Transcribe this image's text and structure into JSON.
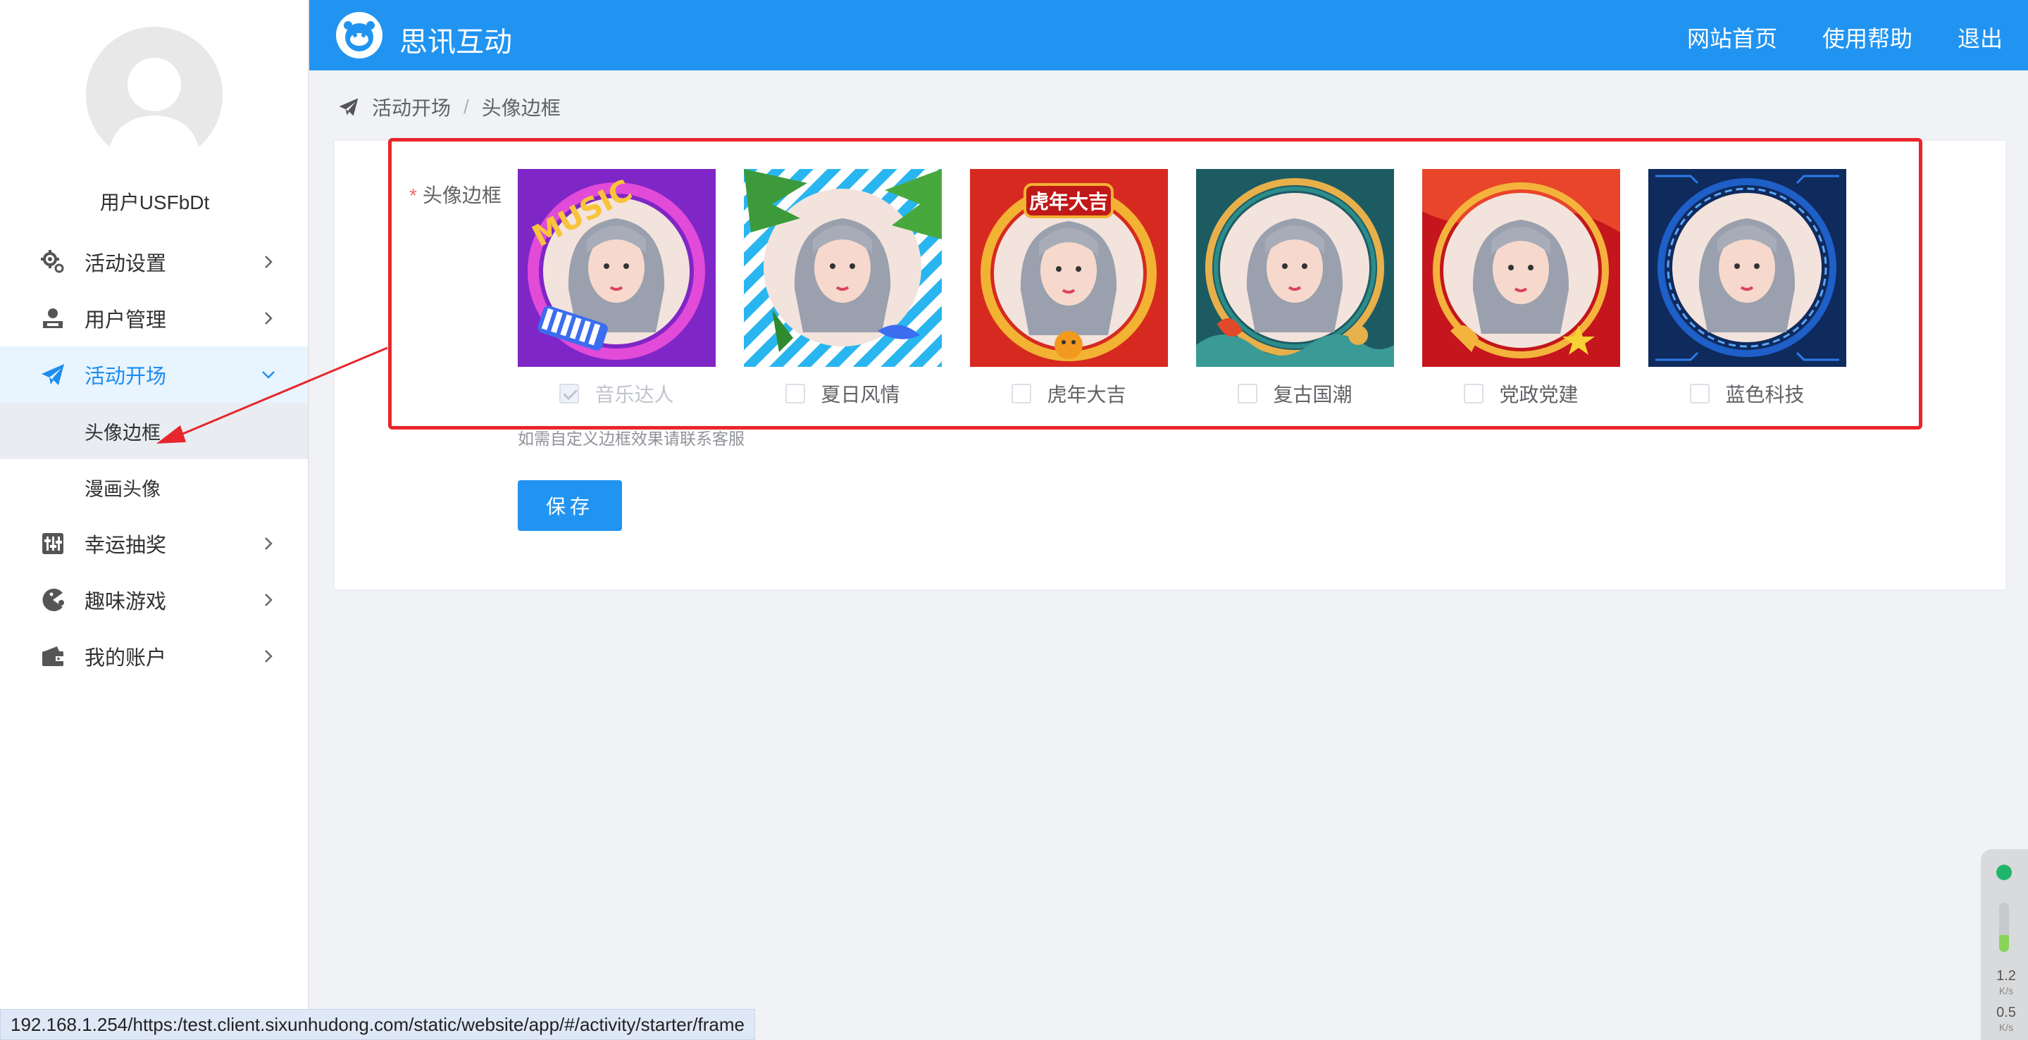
{
  "sidebar": {
    "username": "用户USFbDt",
    "menu": {
      "activity_settings": "活动设置",
      "user_management": "用户管理",
      "activity_start": "活动开场",
      "avatar_frame": "头像边框",
      "comic_avatar": "漫画头像",
      "lucky_draw": "幸运抽奖",
      "fun_games": "趣味游戏",
      "my_account": "我的账户"
    }
  },
  "header": {
    "brand": "思讯互动",
    "links": {
      "home": "网站首页",
      "help": "使用帮助",
      "logout": "退出"
    }
  },
  "breadcrumb": {
    "parent": "活动开场",
    "separator": "/",
    "current": "头像边框"
  },
  "form": {
    "required_mark": "*",
    "label": "头像边框",
    "frames": [
      {
        "label": "音乐达人",
        "checked": true,
        "disabled": true,
        "color": "#8e2bd6"
      },
      {
        "label": "夏日风情",
        "checked": false,
        "disabled": false,
        "color": "#29b6f0"
      },
      {
        "label": "虎年大吉",
        "checked": false,
        "disabled": false,
        "color": "#d62a20"
      },
      {
        "label": "复古国潮",
        "checked": false,
        "disabled": false,
        "color": "#1d5b63"
      },
      {
        "label": "党政党建",
        "checked": false,
        "disabled": false,
        "color": "#c4161c"
      },
      {
        "label": "蓝色科技",
        "checked": false,
        "disabled": false,
        "color": "#0f2a5c"
      }
    ],
    "frame_texts": {
      "music": "MUSIC",
      "tiger": "虎年大吉"
    },
    "hint": "如需自定义边框效果请联系客服",
    "save_label": "保存"
  },
  "statusbar": {
    "url": "192.168.1.254/https:/test.client.sixunhudong.com/static/website/app/#/activity/starter/frame"
  },
  "widget": {
    "upload_rate": "1.2",
    "download_rate": "0.5",
    "unit": "K/s",
    "level": 0.35
  },
  "colors": {
    "accent": "#2194f1",
    "annotation": "#e8262b"
  }
}
